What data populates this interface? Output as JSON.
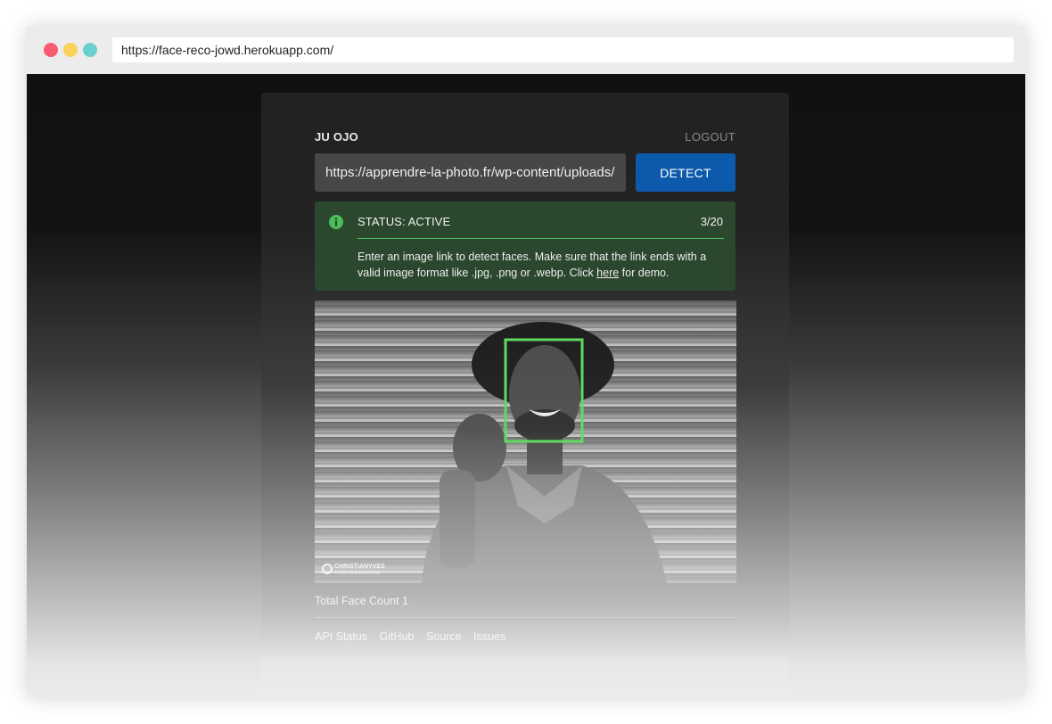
{
  "browser": {
    "url": "https://face-reco-jowd.herokuapp.com/"
  },
  "header": {
    "brand": "JU OJO",
    "logout_label": "LOGOUT"
  },
  "form": {
    "url_value": "https://apprendre-la-photo.fr/wp-content/uploads/",
    "detect_label": "DETECT"
  },
  "status": {
    "title": "STATUS: ACTIVE",
    "count": "3/20",
    "message_before": "Enter an image link to detect faces. Make sure that the link ends with a valid image format like .jpg, .png or .webp. Click ",
    "link_text": "here",
    "message_after": " for demo.",
    "icon": "info-icon"
  },
  "result": {
    "watermark_line1": "CHRISTIANYVES",
    "watermark_line2": "PHOTOGRAPHIE",
    "face_count_text": "Total Face Count 1"
  },
  "footer": {
    "links": [
      "API Status",
      "GitHub",
      "Source",
      "Issues"
    ]
  },
  "colors": {
    "accent_button": "#0d59ab",
    "status_bg": "#2b472e",
    "status_accent": "#4dbd5a",
    "face_box": "#5fdc5f"
  }
}
